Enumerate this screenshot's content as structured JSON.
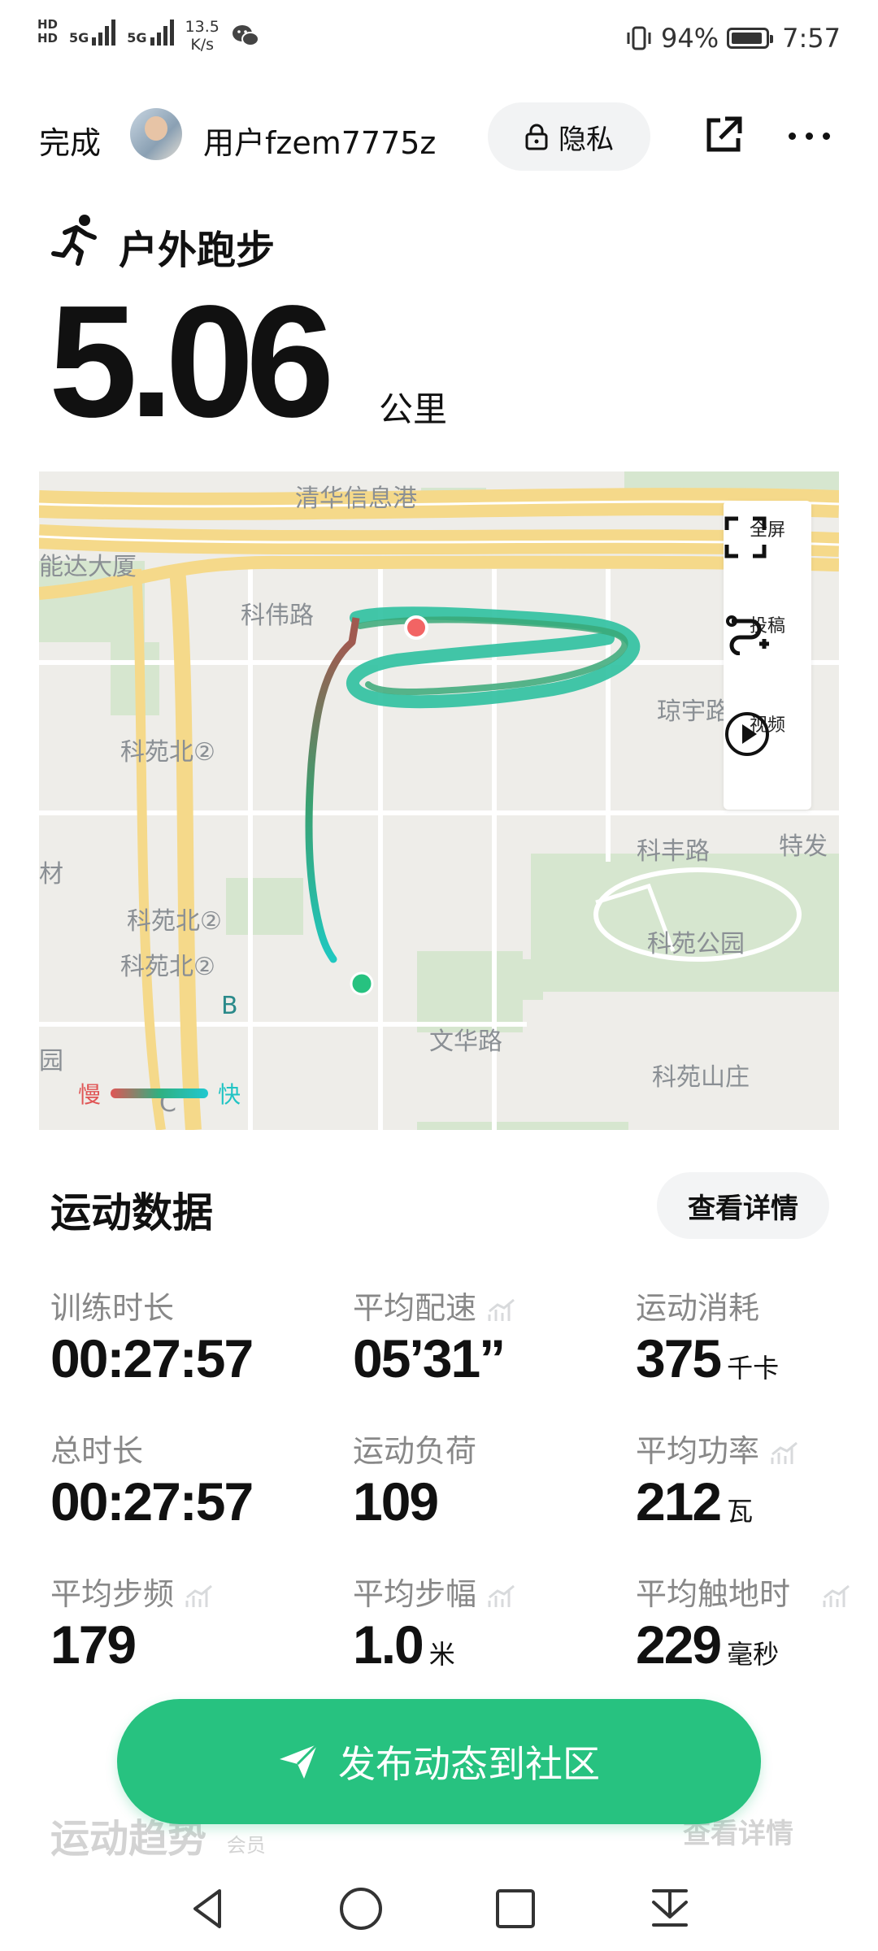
{
  "status_bar": {
    "net1": "HD",
    "net2": "HD",
    "sig1": "5G",
    "sig2": "5G",
    "speed_value": "13.5",
    "speed_unit": "K/s",
    "battery": "94%",
    "time": "7:57"
  },
  "header": {
    "done": "完成",
    "username": "用户fzem7775z",
    "privacy": "隐私"
  },
  "workout": {
    "type": "户外跑步",
    "distance": "5.06",
    "distance_unit": "公里"
  },
  "map": {
    "labels": [
      "清华信息港",
      "能达大厦",
      "科伟路",
      "琼宇路",
      "科苑北②",
      "材",
      "科丰路",
      "特发",
      "科苑北②",
      "科苑北②",
      "科苑公园",
      "B",
      "园",
      "文华路",
      "C",
      "科苑山庄"
    ],
    "controls": {
      "fullscreen": "全屏",
      "submit": "投稿",
      "video": "视频"
    },
    "legend": {
      "slow": "慢",
      "fast": "快"
    }
  },
  "stats": {
    "section_title": "运动数据",
    "detail_button": "查看详情",
    "items": [
      {
        "label": "训练时长",
        "value": "00:27:57",
        "unit": ""
      },
      {
        "label": "平均配速",
        "value": "05’31”",
        "unit": ""
      },
      {
        "label": "运动消耗",
        "value": "375",
        "unit": "千卡"
      },
      {
        "label": "总时长",
        "value": "00:27:57",
        "unit": ""
      },
      {
        "label": "运动负荷",
        "value": "109",
        "unit": ""
      },
      {
        "label": "平均功率",
        "value": "212",
        "unit": "瓦"
      },
      {
        "label": "平均步频",
        "value": "179",
        "unit": ""
      },
      {
        "label": "平均步幅",
        "value": "1.0",
        "unit": "米"
      },
      {
        "label": "平均触地时",
        "value": "229",
        "unit": "毫秒"
      }
    ]
  },
  "publish_button": "发布动态到社区",
  "trend": {
    "title": "运动趋势",
    "badge": "会员",
    "detail_button": "查看详情"
  },
  "colors": {
    "accent": "#27c280",
    "slow": "#e05555",
    "fast": "#20c4c4"
  }
}
